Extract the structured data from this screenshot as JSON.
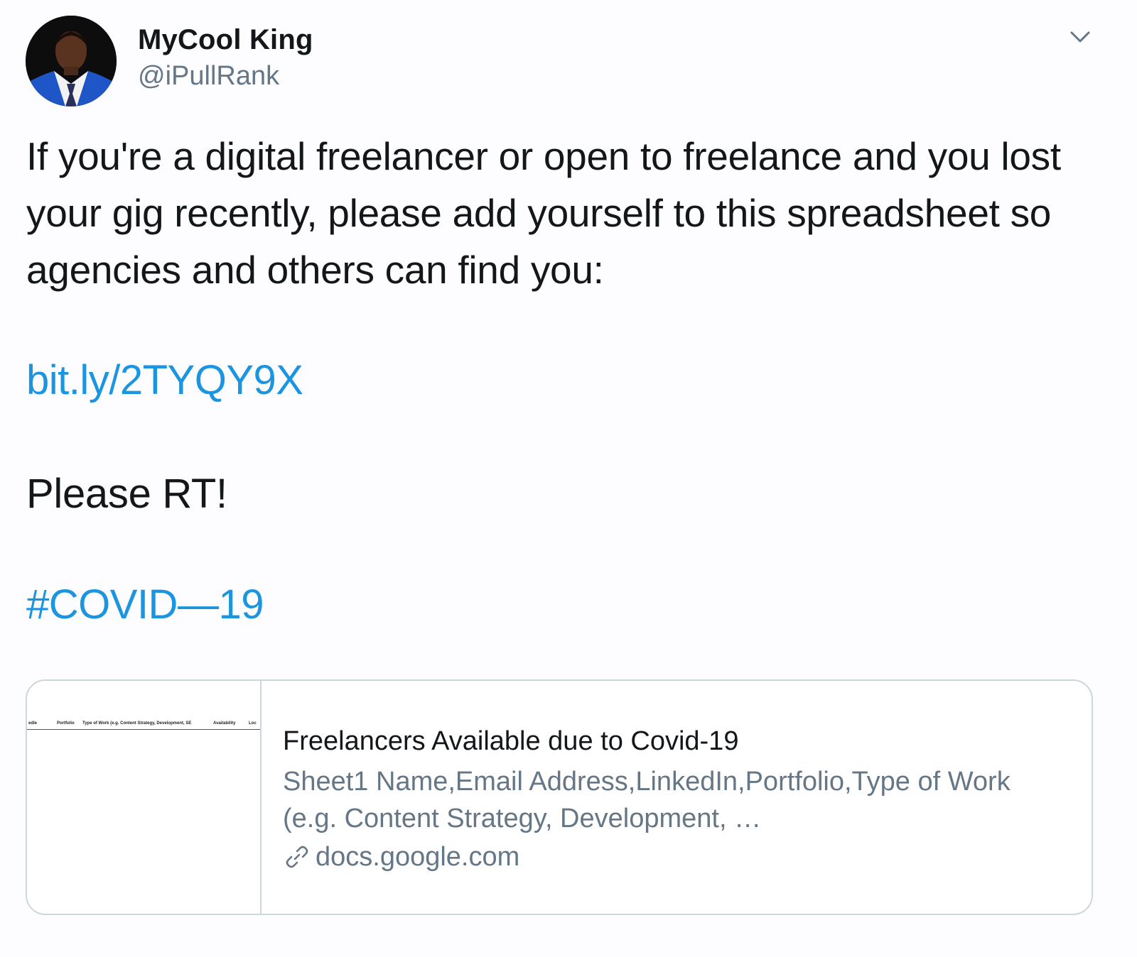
{
  "author": {
    "display_name": "MyCool King",
    "handle": "@iPullRank",
    "avatar_icon": "profile-photo"
  },
  "menu": {
    "caret_icon": "chevron-down-icon"
  },
  "tweet": {
    "text": "If you're a digital freelancer or open to freelance and you lost your gig recently, please add yourself to this spreadsheet so agencies and others can find you:",
    "link": "bit.ly/2TYQY9X",
    "cta": "Please RT!",
    "hashtag": "#COVID—19"
  },
  "card": {
    "thumbnail_headers": [
      "edle",
      "Portfolio",
      "Type of Work (e.g. Content Strategy, Development, SE",
      "Availability",
      "Loc"
    ],
    "title": "Freelancers Available due to Covid-19",
    "description": "Sheet1 Name,Email Address,LinkedIn,Portfolio,Type of Work (e.g. Content Strategy, Development, …",
    "domain": "docs.google.com",
    "domain_icon": "link-icon"
  },
  "colors": {
    "link": "#1b95e0",
    "secondary_text": "#657786",
    "border": "#ccd6dd",
    "primary_text": "#14171a"
  }
}
